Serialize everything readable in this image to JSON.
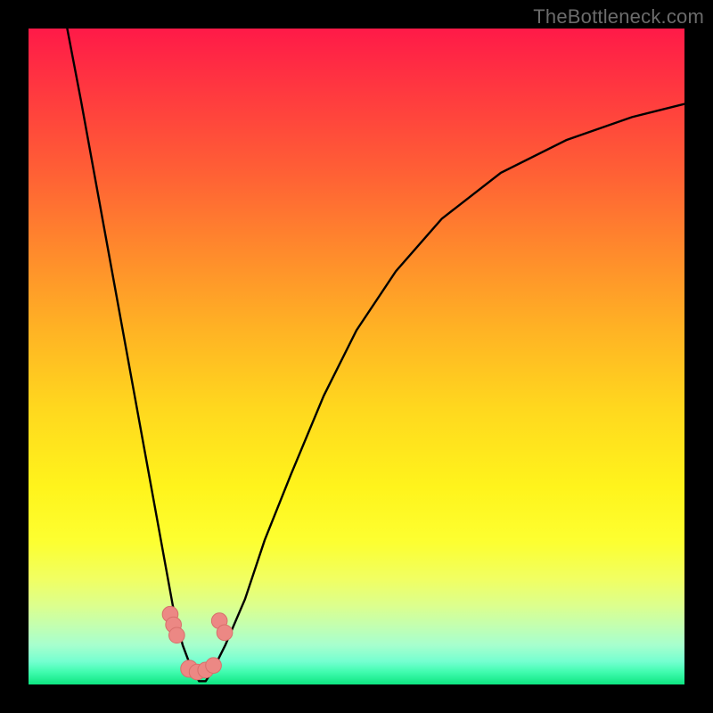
{
  "watermark": "TheBottleneck.com",
  "colors": {
    "background": "#000000",
    "curve": "#000000",
    "marker_fill": "#ec8884",
    "marker_stroke": "#d86f6b"
  },
  "chart_data": {
    "type": "line",
    "title": "",
    "xlabel": "",
    "ylabel": "",
    "xlim": [
      0,
      100
    ],
    "ylim": [
      0,
      100
    ],
    "grid": false,
    "legend": false,
    "note": "Single V-shaped bottleneck curve on vertical color gradient; numeric xy values estimated from pixel positions (percent of plot area, y=0 at bottom).",
    "series": [
      {
        "name": "curve",
        "x": [
          5.9,
          8,
          10,
          12,
          14,
          16,
          18,
          20,
          22,
          23.5,
          25,
          26,
          27,
          28,
          30,
          33,
          36,
          40,
          45,
          50,
          56,
          63,
          72,
          82,
          92,
          100
        ],
        "y": [
          100,
          89,
          78,
          67,
          56,
          45,
          34,
          23,
          12,
          6,
          2,
          0.5,
          0.5,
          2,
          6,
          13,
          22,
          32,
          44,
          54,
          63,
          71,
          78,
          83,
          86.5,
          88.5
        ]
      }
    ],
    "markers": [
      {
        "x": 21.6,
        "y": 10.7,
        "r": 1.2
      },
      {
        "x": 22.1,
        "y": 9.1,
        "r": 1.2
      },
      {
        "x": 22.6,
        "y": 7.5,
        "r": 1.2
      },
      {
        "x": 29.1,
        "y": 9.7,
        "r": 1.2
      },
      {
        "x": 29.9,
        "y": 7.9,
        "r": 1.2
      },
      {
        "x": 24.5,
        "y": 2.4,
        "r": 1.3
      },
      {
        "x": 25.7,
        "y": 1.9,
        "r": 1.2
      },
      {
        "x": 27.0,
        "y": 2.2,
        "r": 1.2
      },
      {
        "x": 28.2,
        "y": 2.9,
        "r": 1.2
      }
    ]
  }
}
